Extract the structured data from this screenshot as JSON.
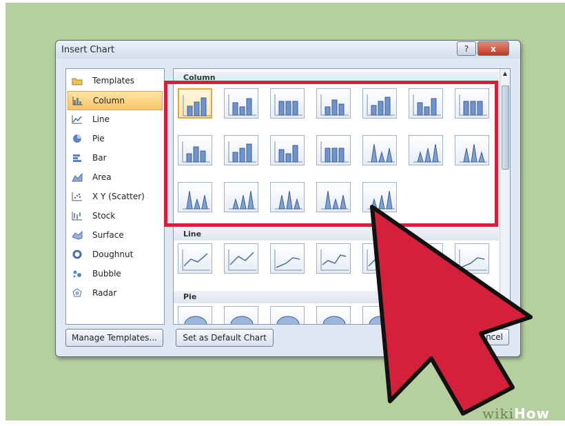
{
  "dialog": {
    "title": "Insert Chart",
    "help_label": "?",
    "close_label": "x"
  },
  "sidebar": {
    "items": [
      {
        "label": "Templates",
        "icon": "folder-icon",
        "selected": false
      },
      {
        "label": "Column",
        "icon": "column-chart-icon",
        "selected": true
      },
      {
        "label": "Line",
        "icon": "line-chart-icon",
        "selected": false
      },
      {
        "label": "Pie",
        "icon": "pie-chart-icon",
        "selected": false
      },
      {
        "label": "Bar",
        "icon": "bar-chart-icon",
        "selected": false
      },
      {
        "label": "Area",
        "icon": "area-chart-icon",
        "selected": false
      },
      {
        "label": "X Y (Scatter)",
        "icon": "scatter-chart-icon",
        "selected": false
      },
      {
        "label": "Stock",
        "icon": "stock-chart-icon",
        "selected": false
      },
      {
        "label": "Surface",
        "icon": "surface-chart-icon",
        "selected": false
      },
      {
        "label": "Doughnut",
        "icon": "doughnut-chart-icon",
        "selected": false
      },
      {
        "label": "Bubble",
        "icon": "bubble-chart-icon",
        "selected": false
      },
      {
        "label": "Radar",
        "icon": "radar-chart-icon",
        "selected": false
      }
    ]
  },
  "gallery": {
    "sections": [
      {
        "header": "Column",
        "tile_count": 19,
        "selected_index": 0
      },
      {
        "header": "Line",
        "tile_count": 7
      },
      {
        "header": "Pie",
        "tile_count": 6
      }
    ]
  },
  "buttons": {
    "manage_templates": "Manage Templates...",
    "set_default": "Set as Default Chart",
    "cancel": "ncel"
  },
  "watermark": {
    "prefix": "wiki",
    "suffix": "How"
  },
  "colors": {
    "highlight_box": "#d4203a",
    "arrow_fill": "#d4203a",
    "background": "#b5cf9f"
  }
}
